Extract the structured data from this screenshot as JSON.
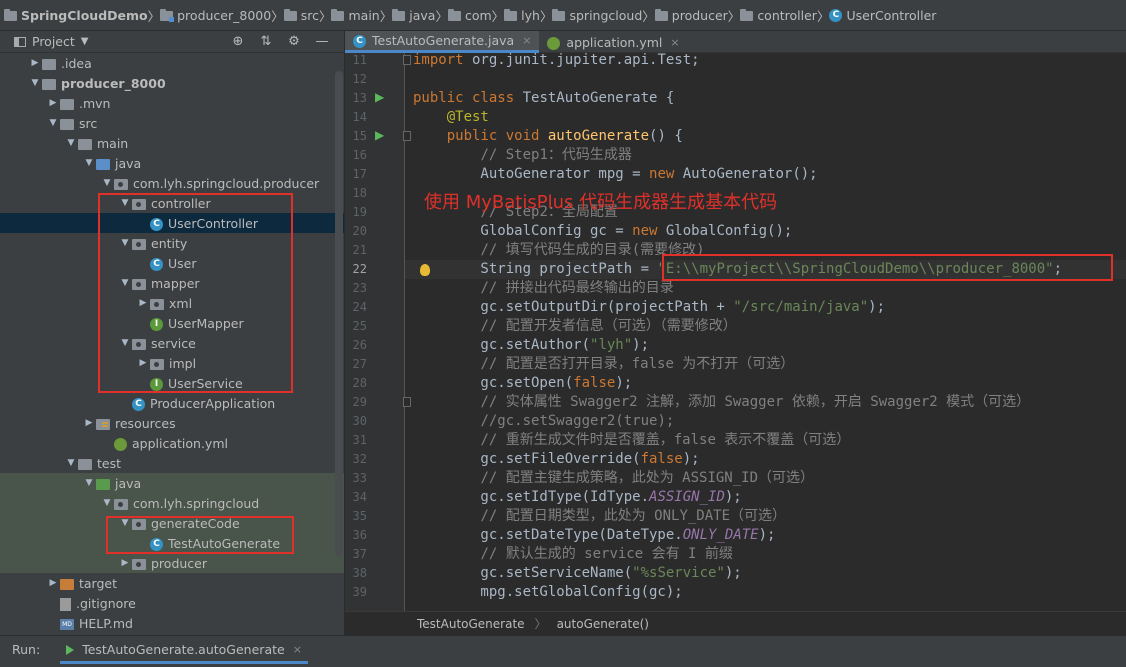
{
  "breadcrumbs": [
    "SpringCloudDemo",
    "producer_8000",
    "src",
    "main",
    "java",
    "com",
    "lyh",
    "springcloud",
    "producer",
    "controller",
    "UserController"
  ],
  "project_pane": {
    "title": "Project",
    "tree": [
      {
        "label": ".idea",
        "depth": 1,
        "arrow": "▶",
        "icon": "folder"
      },
      {
        "label": "producer_8000",
        "depth": 1,
        "arrow": "▼",
        "icon": "folder-module",
        "bold": true
      },
      {
        "label": ".mvn",
        "depth": 2,
        "arrow": "▶",
        "icon": "folder"
      },
      {
        "label": "src",
        "depth": 2,
        "arrow": "▼",
        "icon": "folder"
      },
      {
        "label": "main",
        "depth": 3,
        "arrow": "▼",
        "icon": "folder"
      },
      {
        "label": "java",
        "depth": 4,
        "arrow": "▼",
        "icon": "source-folder"
      },
      {
        "label": "com.lyh.springcloud.producer",
        "depth": 5,
        "arrow": "▼",
        "icon": "package"
      },
      {
        "label": "controller",
        "depth": 6,
        "arrow": "▼",
        "icon": "package"
      },
      {
        "label": "UserController",
        "depth": 7,
        "arrow": "",
        "icon": "class",
        "selected": true
      },
      {
        "label": "entity",
        "depth": 6,
        "arrow": "▼",
        "icon": "package"
      },
      {
        "label": "User",
        "depth": 7,
        "arrow": "",
        "icon": "class"
      },
      {
        "label": "mapper",
        "depth": 6,
        "arrow": "▼",
        "icon": "package"
      },
      {
        "label": "xml",
        "depth": 7,
        "arrow": "▶",
        "icon": "package"
      },
      {
        "label": "UserMapper",
        "depth": 7,
        "arrow": "",
        "icon": "interface"
      },
      {
        "label": "service",
        "depth": 6,
        "arrow": "▼",
        "icon": "package"
      },
      {
        "label": "impl",
        "depth": 7,
        "arrow": "▶",
        "icon": "package"
      },
      {
        "label": "UserService",
        "depth": 7,
        "arrow": "",
        "icon": "interface"
      },
      {
        "label": "ProducerApplication",
        "depth": 6,
        "arrow": "",
        "icon": "class"
      },
      {
        "label": "resources",
        "depth": 4,
        "arrow": "▶",
        "icon": "resources-folder"
      },
      {
        "label": "application.yml",
        "depth": 5,
        "arrow": "",
        "icon": "yml"
      },
      {
        "label": "test",
        "depth": 3,
        "arrow": "▼",
        "icon": "folder"
      },
      {
        "label": "java",
        "depth": 4,
        "arrow": "▼",
        "icon": "test-folder",
        "test": true
      },
      {
        "label": "com.lyh.springcloud",
        "depth": 5,
        "arrow": "▼",
        "icon": "package",
        "test": true
      },
      {
        "label": "generateCode",
        "depth": 6,
        "arrow": "▼",
        "icon": "package",
        "test": true
      },
      {
        "label": "TestAutoGenerate",
        "depth": 7,
        "arrow": "",
        "icon": "class",
        "test": true
      },
      {
        "label": "producer",
        "depth": 6,
        "arrow": "▶",
        "icon": "package",
        "test": true
      },
      {
        "label": "target",
        "depth": 2,
        "arrow": "▶",
        "icon": "target-folder"
      },
      {
        "label": ".gitignore",
        "depth": 2,
        "arrow": "",
        "icon": "gitignore"
      },
      {
        "label": "HELP.md",
        "depth": 2,
        "arrow": "",
        "icon": "markdown"
      }
    ]
  },
  "editor_tabs": [
    {
      "label": "TestAutoGenerate.java",
      "active": true,
      "icon": "class-icon"
    },
    {
      "label": "application.yml",
      "active": false,
      "icon": "yml-icon"
    }
  ],
  "editor": {
    "current_line": 22,
    "lines": [
      {
        "n": 11,
        "html": "<span class=\"kw\">import</span> org.junit.jupiter.api.Test;"
      },
      {
        "n": 12,
        "html": ""
      },
      {
        "n": 13,
        "html": "<span class=\"kw\">public class</span> TestAutoGenerate {"
      },
      {
        "n": 14,
        "html": "    <span class=\"an\">@Test</span>"
      },
      {
        "n": 15,
        "html": "    <span class=\"kw\">public void</span> <span class=\"fn\">autoGenerate</span>() {"
      },
      {
        "n": 16,
        "html": "        <span class=\"cm\">// Step1：代码生成器</span>"
      },
      {
        "n": 17,
        "html": "        AutoGenerator mpg = <span class=\"kw\">new</span> AutoGenerator();"
      },
      {
        "n": 18,
        "html": ""
      },
      {
        "n": 19,
        "html": "        <span class=\"cm\">// Step2：全局配置</span>"
      },
      {
        "n": 20,
        "html": "        GlobalConfig gc = <span class=\"kw\">new</span> GlobalConfig();"
      },
      {
        "n": 21,
        "html": "        <span class=\"cm\">// 填写代码生成的目录(需要修改)</span>"
      },
      {
        "n": 22,
        "html": "        String projectPath = <span class=\"str\">\"E:\\\\myProject\\\\SpringCloudDemo\\\\producer_8000\"</span>;"
      },
      {
        "n": 23,
        "html": "        <span class=\"cm\">// 拼接出代码最终输出的目录</span>"
      },
      {
        "n": 24,
        "html": "        gc.setOutputDir(projectPath + <span class=\"str\">\"/src/main/java\"</span>);"
      },
      {
        "n": 25,
        "html": "        <span class=\"cm\">// 配置开发者信息（可选）（需要修改）</span>"
      },
      {
        "n": 26,
        "html": "        gc.setAuthor(<span class=\"str\">\"lyh\"</span>);"
      },
      {
        "n": 27,
        "html": "        <span class=\"cm\">// 配置是否打开目录，false 为不打开（可选）</span>"
      },
      {
        "n": 28,
        "html": "        gc.setOpen(<span class=\"kw\">false</span>);"
      },
      {
        "n": 29,
        "html": "        <span class=\"cm\">// 实体属性 Swagger2 注解，添加 Swagger 依赖，开启 Swagger2 模式（可选）</span>"
      },
      {
        "n": 30,
        "html": "        <span class=\"cm\">//gc.setSwagger2(true);</span>"
      },
      {
        "n": 31,
        "html": "        <span class=\"cm\">// 重新生成文件时是否覆盖，false 表示不覆盖（可选）</span>"
      },
      {
        "n": 32,
        "html": "        gc.setFileOverride(<span class=\"kw\">false</span>);"
      },
      {
        "n": 33,
        "html": "        <span class=\"cm\">// 配置主键生成策略，此处为 ASSIGN_ID（可选）</span>"
      },
      {
        "n": 34,
        "html": "        gc.setIdType(IdType.<span class=\"st\">ASSIGN_ID</span>);"
      },
      {
        "n": 35,
        "html": "        <span class=\"cm\">// 配置日期类型，此处为 ONLY_DATE（可选）</span>"
      },
      {
        "n": 36,
        "html": "        gc.setDateType(DateType.<span class=\"st\">ONLY_DATE</span>);"
      },
      {
        "n": 37,
        "html": "        <span class=\"cm\">// 默认生成的 service 会有 I 前缀</span>"
      },
      {
        "n": 38,
        "html": "        gc.setServiceName(<span class=\"str\">\"%sService\"</span>);"
      },
      {
        "n": 39,
        "html": "        mpg.setGlobalConfig(gc);"
      }
    ]
  },
  "annotation_note": "使用 MyBatisPlus 代码生成器生成基本代码",
  "editor_breadcrumbs": [
    "TestAutoGenerate",
    "autoGenerate()"
  ],
  "run_bar": {
    "label": "Run:",
    "tab": "TestAutoGenerate.autoGenerate"
  }
}
